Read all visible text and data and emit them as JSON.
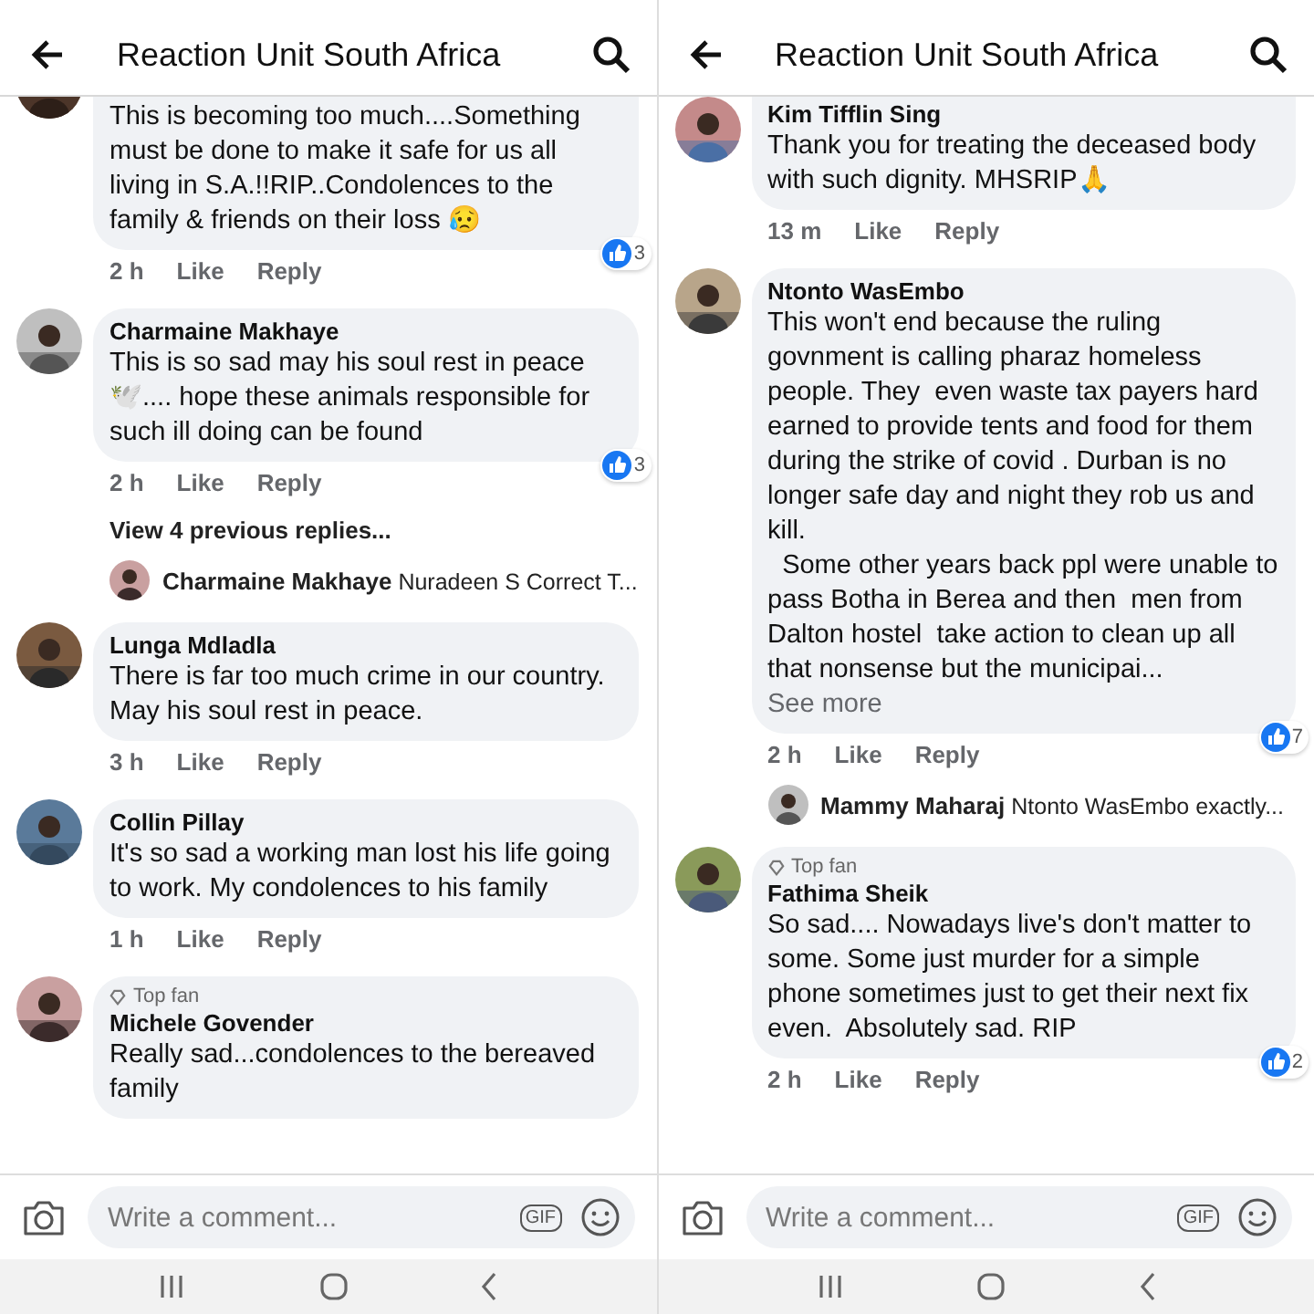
{
  "panels": [
    {
      "title": "Reaction Unit South Africa",
      "comments": [
        {
          "cut_top": true,
          "text": "This is becoming too much....Something must be done to make it safe for us all living in S.A.!!RIP..Condolences to the family & friends on their loss 😥",
          "time": "2 h",
          "like": "Like",
          "reply": "Reply",
          "reactions": "3"
        },
        {
          "author": "Charmaine Makhaye",
          "text": "This is so sad may his soul rest in peace 🕊️.... hope these animals responsible for such ill doing can be found",
          "time": "2 h",
          "like": "Like",
          "reply": "Reply",
          "reactions": "3",
          "more_replies": "View 4 previous replies...",
          "reply_preview": {
            "author": "Charmaine Makhaye",
            "text": "Nuradeen S Correct T..."
          }
        },
        {
          "author": "Lunga Mdladla",
          "text": "There is far too much crime in our country. May his soul rest in peace.",
          "time": "3 h",
          "like": "Like",
          "reply": "Reply"
        },
        {
          "author": "Collin Pillay",
          "text": "It's so sad a working man lost his life going to work. My condolences to his family",
          "time": "1 h",
          "like": "Like",
          "reply": "Reply"
        },
        {
          "top_fan": "Top fan",
          "author": "Michele Govender",
          "text": "Really sad...condolences to the bereaved family"
        }
      ],
      "composer": {
        "placeholder": "Write a comment...",
        "gif": "GIF"
      }
    },
    {
      "title": "Reaction Unit South Africa",
      "comments": [
        {
          "cut_top": true,
          "author": "Kim Tifflin Sing",
          "text": "Thank you for treating the deceased body with such dignity. MHSRIP🙏",
          "time": "13 m",
          "like": "Like",
          "reply": "Reply"
        },
        {
          "author": "Ntonto WasEmbo",
          "text": "This won't end because the ruling govnment is calling pharaz homeless people. They  even waste tax payers hard earned to provide tents and food for them during the strike of covid . Durban is no longer safe day and night they rob us and kill.\n  Some other years back ppl were unable to pass Botha in Berea and then  men from Dalton hostel  take action to clean up all that nonsense but the municipai...",
          "see_more": "See more",
          "time": "2 h",
          "like": "Like",
          "reply": "Reply",
          "reactions": "7",
          "reply_preview": {
            "author": "Mammy Maharaj",
            "text": "Ntonto WasEmbo exactly..."
          }
        },
        {
          "top_fan": "Top fan",
          "author": "Fathima Sheik",
          "text": "So sad.... Nowadays live's don't matter to some. Some just murder for a simple phone sometimes just to get their next fix even.  Absolutely sad. RIP",
          "time": "2 h",
          "like": "Like",
          "reply": "Reply",
          "reactions": "2"
        }
      ],
      "composer": {
        "placeholder": "Write a comment...",
        "gif": "GIF"
      }
    }
  ]
}
